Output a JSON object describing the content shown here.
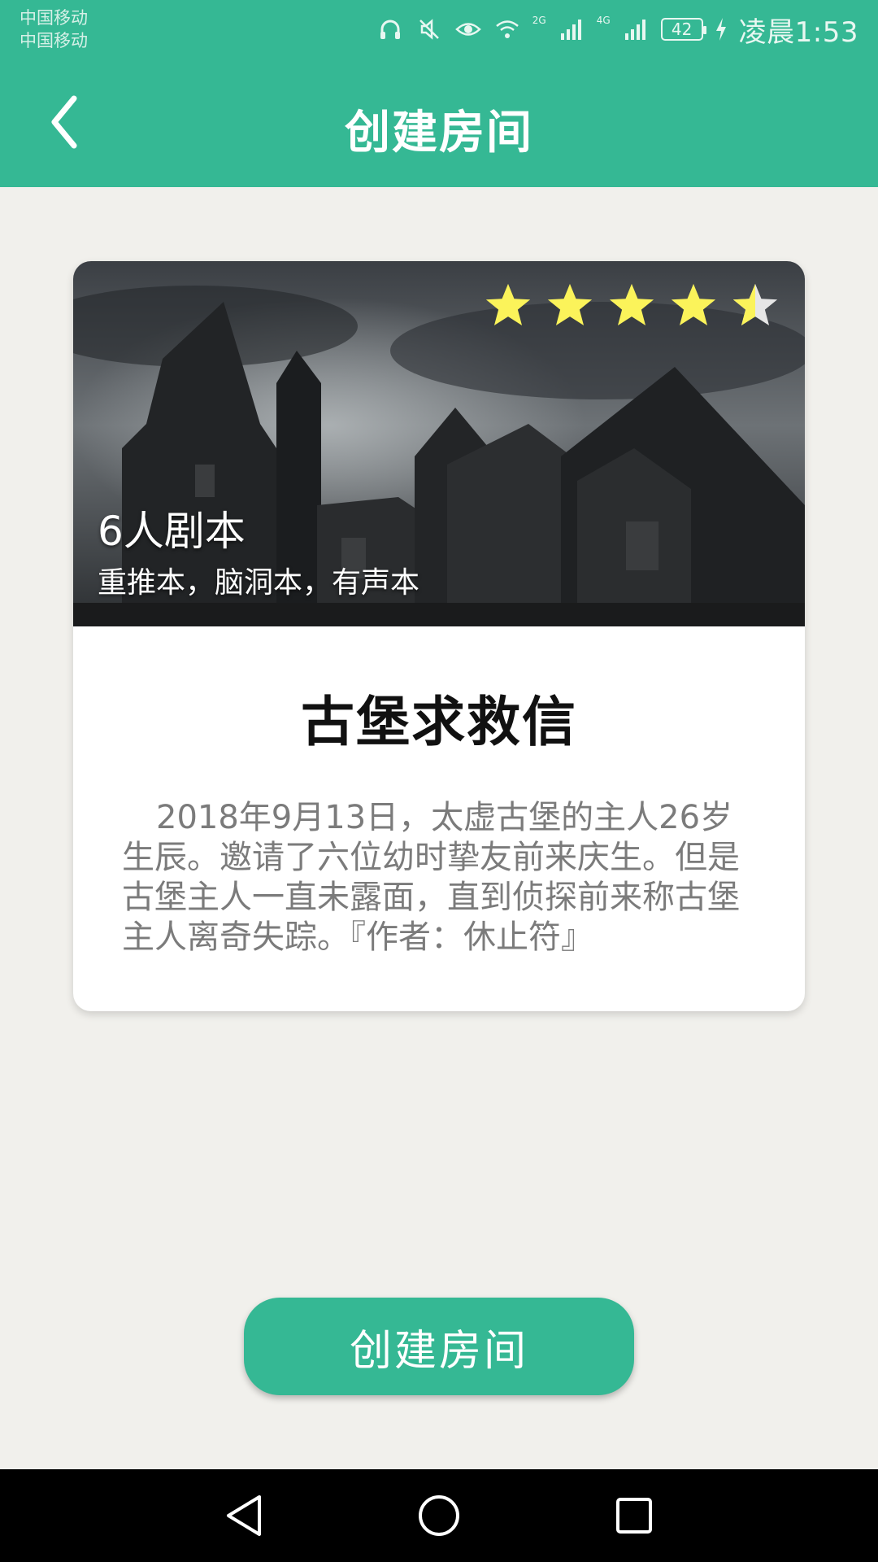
{
  "status_bar": {
    "carrier_1": "中国移动",
    "carrier_2": "中国移动",
    "network_1": "2G",
    "network_2": "4G",
    "battery": "42",
    "time": "凌晨1:53",
    "icons": [
      "headphones-icon",
      "mute-icon",
      "eye-icon",
      "wifi-icon",
      "signal-icon",
      "signal-icon",
      "battery-icon",
      "charging-icon"
    ]
  },
  "header": {
    "title": "创建房间",
    "back_icon": "chevron-left-icon",
    "background_color": "#35b894"
  },
  "script_card": {
    "rating": 4.5,
    "rating_max": 5,
    "players_label": "6人剧本",
    "tags": "重推本，脑洞本，有声本",
    "title": "古堡求救信",
    "description": "2018年9月13日，太虚古堡的主人26岁生辰。邀请了六位幼时挚友前来庆生。但是古堡主人一直未露面，直到侦探前来称古堡主人离奇失踪。『作者：休止符』",
    "star_color": "#fbf35a"
  },
  "actions": {
    "create_label": "创建房间",
    "accent_color": "#35b894"
  },
  "nav_bar": {
    "icons": [
      "back-triangle-icon",
      "home-circle-icon",
      "recents-square-icon"
    ]
  }
}
